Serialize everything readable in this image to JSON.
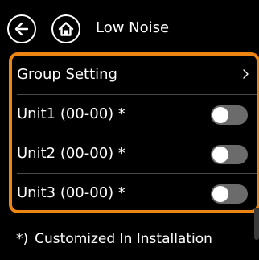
{
  "header": {
    "title": "Low Noise",
    "back_icon": "arrow-left-icon",
    "home_icon": "home-icon"
  },
  "list": {
    "group_setting": {
      "label": "Group Setting",
      "icon": "chevron-right-icon"
    },
    "units": [
      {
        "label": "Unit1 (00-00) *",
        "enabled": false
      },
      {
        "label": "Unit2 (00-00) *",
        "enabled": false
      },
      {
        "label": "Unit3 (00-00) *",
        "enabled": false
      }
    ]
  },
  "footnote": {
    "mark": "*)",
    "text": "Customized In Installation"
  },
  "colors": {
    "background": "#000000",
    "highlight_border": "#ec8512",
    "toggle_off": "#6b6b6b",
    "divider": "#4a4a4a"
  }
}
